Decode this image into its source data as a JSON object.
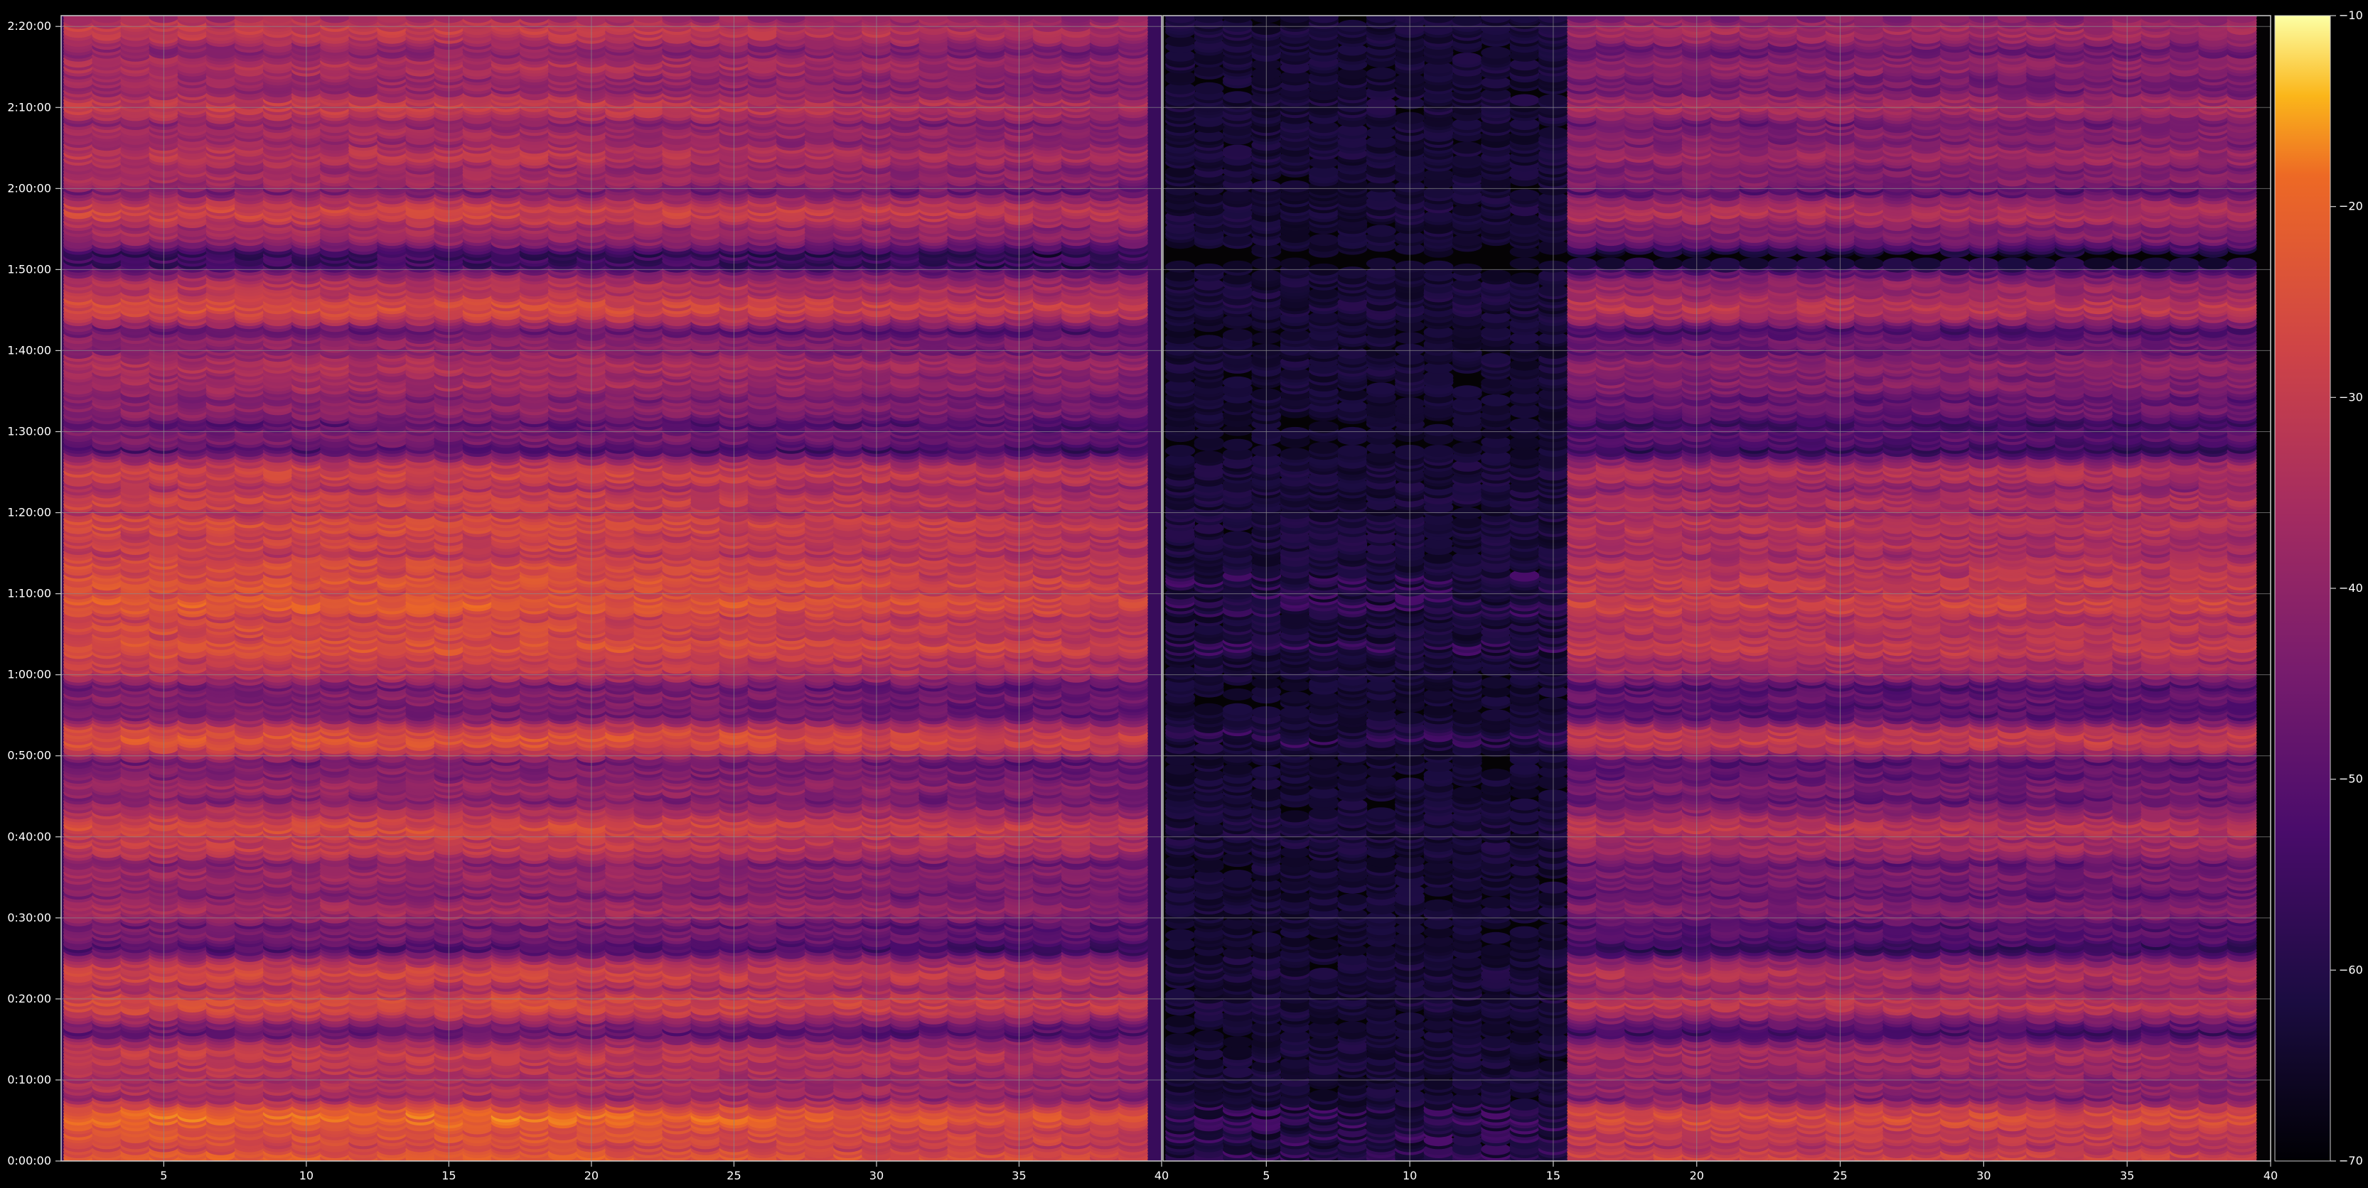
{
  "chart_data": {
    "type": "heatmap",
    "title": "",
    "xlabel": "",
    "ylabel": "",
    "grid": true,
    "background_color": "#000000",
    "grid_color": "#8a8a8a",
    "colormap": "inferno",
    "colorbar": {
      "range": [
        -70,
        -10
      ],
      "ticks": [
        -10,
        -20,
        -30,
        -40,
        -50,
        -60,
        -70
      ],
      "tick_labels": [
        "−10",
        "−20",
        "−30",
        "−40",
        "−50",
        "−60",
        "−70"
      ],
      "placement": "right"
    },
    "y_axis": {
      "ylim_seconds": [
        0,
        8480
      ],
      "ticks": [
        {
          "value": 0,
          "label": "0:00:00"
        },
        {
          "value": 600,
          "label": "0:10:00"
        },
        {
          "value": 1200,
          "label": "0:20:00"
        },
        {
          "value": 1800,
          "label": "0:30:00"
        },
        {
          "value": 2400,
          "label": "0:40:00"
        },
        {
          "value": 3000,
          "label": "0:50:00"
        },
        {
          "value": 3600,
          "label": "1:00:00"
        },
        {
          "value": 4200,
          "label": "1:10:00"
        },
        {
          "value": 4800,
          "label": "1:20:00"
        },
        {
          "value": 5400,
          "label": "1:30:00"
        },
        {
          "value": 6000,
          "label": "1:40:00"
        },
        {
          "value": 6600,
          "label": "1:50:00"
        },
        {
          "value": 7200,
          "label": "2:00:00"
        },
        {
          "value": 7800,
          "label": "2:10:00"
        },
        {
          "value": 8400,
          "label": "2:20:00"
        }
      ]
    },
    "panels": [
      {
        "name": "left",
        "xlim": [
          1.4,
          40
        ],
        "x_ticks": [
          5,
          10,
          15,
          20,
          25,
          30,
          35,
          40
        ],
        "x_tick_labels": [
          "5",
          "10",
          "15",
          "20",
          "25",
          "30",
          "35",
          "40"
        ],
        "channel_range": [
          2,
          39
        ],
        "base_level_dB": -38,
        "high_freq_rolloff_dB": 6
      },
      {
        "name": "right",
        "xlim": [
          1.4,
          40
        ],
        "x_ticks": [
          5,
          10,
          15,
          20,
          25,
          30,
          35,
          40
        ],
        "x_tick_labels": [
          "5",
          "10",
          "15",
          "20",
          "25",
          "30",
          "35",
          "40"
        ],
        "channel_range": [
          2,
          39
        ],
        "base_level_dB": -64,
        "active_from_channel": 16,
        "note_low_channels_quiet": true
      }
    ],
    "bands": [
      {
        "t": 30,
        "level": -22
      },
      {
        "t": 110,
        "level": -30
      },
      {
        "t": 200,
        "level": -24
      },
      {
        "t": 330,
        "level": -20
      },
      {
        "t": 470,
        "level": -38
      },
      {
        "t": 560,
        "level": -34
      },
      {
        "t": 700,
        "level": -32
      },
      {
        "t": 800,
        "level": -30
      },
      {
        "t": 1060,
        "level": -42
      },
      {
        "t": 1180,
        "level": -26
      },
      {
        "t": 1260,
        "level": -34
      },
      {
        "t": 1400,
        "level": -28
      },
      {
        "t": 1460,
        "level": -40
      },
      {
        "t": 1700,
        "level": -44
      },
      {
        "t": 1880,
        "level": -36
      },
      {
        "t": 2050,
        "level": -40
      },
      {
        "t": 2140,
        "level": -38
      },
      {
        "t": 2260,
        "level": -46
      },
      {
        "t": 2350,
        "level": -30
      },
      {
        "t": 2480,
        "level": -26
      },
      {
        "t": 2580,
        "level": -34
      },
      {
        "t": 2780,
        "level": -38
      },
      {
        "t": 2900,
        "level": -42
      },
      {
        "t": 3140,
        "level": -24
      },
      {
        "t": 3350,
        "level": -44
      },
      {
        "t": 3450,
        "level": -42
      },
      {
        "t": 3680,
        "level": -30
      },
      {
        "t": 3820,
        "level": -24
      },
      {
        "t": 3960,
        "level": -26
      },
      {
        "t": 4140,
        "level": -22
      },
      {
        "t": 4290,
        "level": -24
      },
      {
        "t": 4420,
        "level": -26
      },
      {
        "t": 4580,
        "level": -28
      },
      {
        "t": 4720,
        "level": -26
      },
      {
        "t": 4900,
        "level": -28
      },
      {
        "t": 5100,
        "level": -28
      },
      {
        "t": 5380,
        "level": -44
      },
      {
        "t": 5590,
        "level": -40
      },
      {
        "t": 5770,
        "level": -36
      },
      {
        "t": 5900,
        "level": -34
      },
      {
        "t": 6060,
        "level": -40
      },
      {
        "t": 6340,
        "level": -26
      },
      {
        "t": 6470,
        "level": -32
      },
      {
        "t": 6900,
        "level": -36
      },
      {
        "t": 7040,
        "level": -28
      },
      {
        "t": 7300,
        "level": -36
      },
      {
        "t": 7460,
        "level": -32
      },
      {
        "t": 7620,
        "level": -36
      },
      {
        "t": 7820,
        "level": -30
      },
      {
        "t": 7990,
        "level": -38
      },
      {
        "t": 8120,
        "level": -34
      },
      {
        "t": 8250,
        "level": -40
      },
      {
        "t": 8380,
        "level": -30
      }
    ]
  }
}
